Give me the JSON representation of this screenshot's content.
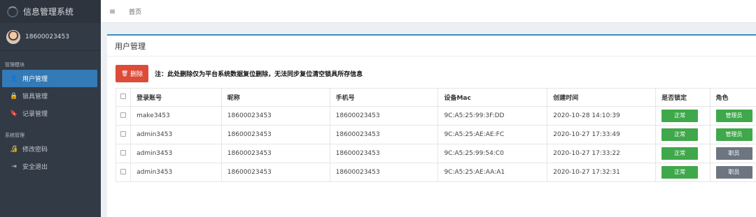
{
  "app": {
    "title": "信息管理系统"
  },
  "user": {
    "name": "18600023453"
  },
  "sidebar": {
    "section1": "管理模块",
    "items1": [
      {
        "label": "用户管理",
        "icon": "user-icon",
        "glyph": "👤"
      },
      {
        "label": "锁具管理",
        "icon": "lock-icon",
        "glyph": "🔒"
      },
      {
        "label": "记录管理",
        "icon": "bookmark-icon",
        "glyph": "🔖"
      }
    ],
    "section2": "系统管理",
    "items2": [
      {
        "label": "修改密码",
        "icon": "key-icon",
        "glyph": "🔏"
      },
      {
        "label": "安全退出",
        "icon": "sign-out-icon",
        "glyph": "⇥"
      }
    ]
  },
  "topbar": {
    "menu_glyph": "≡",
    "home": "首页"
  },
  "panel": {
    "title": "用户管理"
  },
  "actions": {
    "delete_label": "删除",
    "note": "注：此处删除仅为平台系统数据复位删除，无法同步复位清空锁具所存信息"
  },
  "table": {
    "headers": [
      "登录账号",
      "昵称",
      "手机号",
      "设备Mac",
      "创建时间",
      "是否锁定",
      "角色"
    ],
    "rows": [
      {
        "account": "make3453",
        "nickname": "18600023453",
        "phone": "18600023453",
        "mac": "9C:A5:25:99:3F:DD",
        "created": "2020-10-28 14:10:39",
        "locked": "正常",
        "role": "管理员"
      },
      {
        "account": "admin3453",
        "nickname": "18600023453",
        "phone": "18600023453",
        "mac": "9C:A5:25:AE:AE:FC",
        "created": "2020-10-27 17:33:49",
        "locked": "正常",
        "role": "管理员"
      },
      {
        "account": "admin3453",
        "nickname": "18600023453",
        "phone": "18600023453",
        "mac": "9C:A5:25:99:54:C0",
        "created": "2020-10-27 17:33:22",
        "locked": "正常",
        "role": "职员"
      },
      {
        "account": "admin3453",
        "nickname": "18600023453",
        "phone": "18600023453",
        "mac": "9C:A5:25:AE:AA:A1",
        "created": "2020-10-27 17:32:31",
        "locked": "正常",
        "role": "职员"
      }
    ]
  },
  "colors": {
    "sidebar": "#323a45",
    "active": "#337ab7",
    "danger": "#dd4b39",
    "success": "#3fa84a",
    "muted": "#6d7580",
    "accent": "#3c8dbc"
  }
}
